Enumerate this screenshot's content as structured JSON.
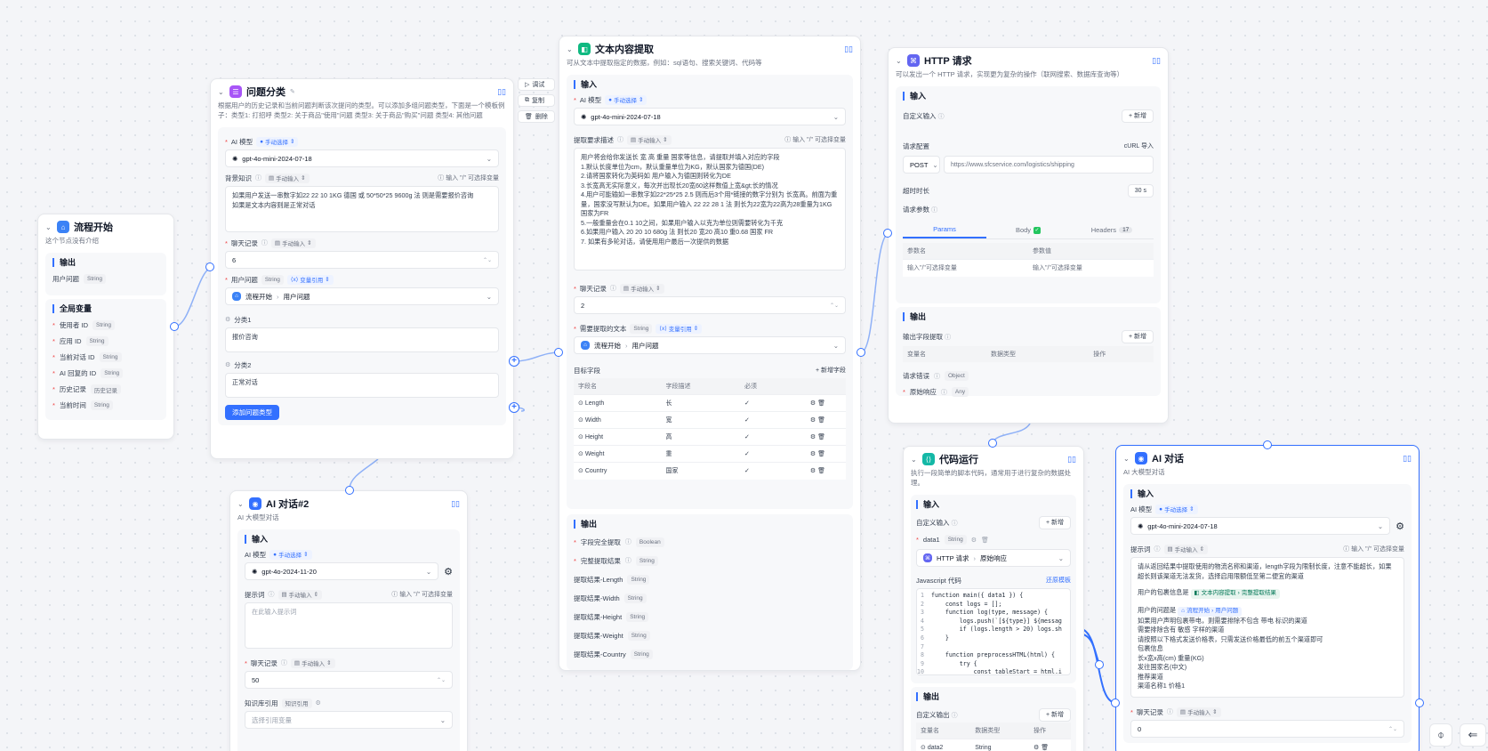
{
  "start": {
    "title": "流程开始",
    "desc": "这个节点没有介绍",
    "output_label": "输出",
    "output_field": "用户问题",
    "output_type": "String",
    "globals_label": "全局变量",
    "globals": [
      {
        "name": "使用者 ID",
        "type": "String"
      },
      {
        "name": "应用 ID",
        "type": "String"
      },
      {
        "name": "当前对话 ID",
        "type": "String"
      },
      {
        "name": "AI 回复的 ID",
        "type": "String"
      },
      {
        "name": "历史记录",
        "type": "历史记录"
      },
      {
        "name": "当前时间",
        "type": "String"
      }
    ]
  },
  "toolbar": {
    "debug": "调试",
    "copy": "复制",
    "delete": "删除"
  },
  "classify": {
    "title": "问题分类",
    "desc": "根据用户的历史记录和当前问题判断该次提问的类型。可以添加多组问题类型，下面是一个模板例子：类型1: 打招呼 类型2: 关于商品\"使用\"问题 类型3: 关于商品\"购买\"问题 类型4: 其他问题",
    "model_label": "AI 模型",
    "mode": "手动选择",
    "model": "gpt-4o-mini-2024-07-18",
    "bg_label": "背景知识",
    "manual": "手动输入",
    "hint": "输入 \"/\" 可选择变量",
    "bg_text": "如果用户发送一串数字如22 22 10 1KG 德国 或 50*50*25 9600g 法 则是需要报价咨询\n如果是文本内容则是正常对话",
    "history_label": "聊天记录",
    "history_val": "6",
    "q_label": "用户问题",
    "q_type": "String",
    "ref": "变量引用",
    "q_ref_a": "流程开始",
    "q_ref_b": "用户问题",
    "class1_label": "分类1",
    "class1_val": "报价咨询",
    "class2_label": "分类2",
    "class2_val": "正常对话",
    "add_btn": "添加问题类型"
  },
  "extract": {
    "title": "文本内容提取",
    "desc": "可从文本中提取指定的数据，例如：sql语句、搜索关键词、代码等",
    "input_label": "输入",
    "model_label": "AI 模型",
    "mode": "手动选择",
    "model": "gpt-4o-mini-2024-07-18",
    "req_label": "提取要求描述",
    "manual": "手动输入",
    "hint": "输入 \"/\" 可选择变量",
    "req_text": "用户将会给你发送长 宽 高 重量 国家等信息，请提取并填入对应的字段\n1.默认长度单位为cm，默认重量单位为KG，默认国家为德国(DE)\n2.请将国家转化为英码如 用户输入为德国则转化为DE\n3.长宽高无实际意义，每次并出现长20宽60这样数值上宽&gt;长的情况\n4.用户可能输如一串数字如22*25*25 2.5 则而后3个用*链接的数字分别为 长宽高。前面为重量，国家没写默认为DE。如果用户输入 22 22 28 1 法 则长为22宽为22高为28重量为1KG 国家为FR\n5.一般重量会在0.1  10之间，如果用户输入以克为单位则需要转化为千克\n6.如果用户输入 20 20 10 680g 法 则长20 宽20 高10 重0.68 国家 FR\n7. 如果有多轮对话，请使用用户最后一次提供的数据",
    "history_label": "聊天记录",
    "history_val": "2",
    "text_label": "需要提取的文本",
    "text_type": "String",
    "ref": "变量引用",
    "text_ref_a": "流程开始",
    "text_ref_b": "用户问题",
    "target_label": "目标字段",
    "add_field": "+ 新增字段",
    "cols": [
      "字段名",
      "字段描述",
      "必须"
    ],
    "fields": [
      {
        "name": "Length",
        "desc": "长"
      },
      {
        "name": "Width",
        "desc": "宽"
      },
      {
        "name": "Height",
        "desc": "高"
      },
      {
        "name": "Weight",
        "desc": "重"
      },
      {
        "name": "Country",
        "desc": "国家"
      }
    ],
    "output_label": "输出",
    "outputs": [
      {
        "name": "字段完全提取",
        "type": "Boolean",
        "req": true
      },
      {
        "name": "完整提取结果",
        "type": "String",
        "req": true
      },
      {
        "name": "提取结果-Length",
        "type": "String",
        "req": false
      },
      {
        "name": "提取结果-Width",
        "type": "String",
        "req": false
      },
      {
        "name": "提取结果-Height",
        "type": "String",
        "req": false
      },
      {
        "name": "提取结果-Weight",
        "type": "String",
        "req": false
      },
      {
        "name": "提取结果-Country",
        "type": "String",
        "req": false
      }
    ]
  },
  "http": {
    "title": "HTTP 请求",
    "desc": "可以发出一个 HTTP 请求，实现更为复杂的操作（联网搜索、数据库查询等）",
    "input_label": "输入",
    "custom_input": "自定义输入",
    "add": "+ 新增",
    "config_label": "请求配置",
    "curl": "cURL 导入",
    "method": "POST",
    "url": "https://www.sfcservice.com/logistics/shipping",
    "timeout_label": "超时时长",
    "timeout": "30 s",
    "params_label": "请求参数",
    "tabs": [
      "Params",
      "Body",
      "Headers"
    ],
    "headers_count": "17",
    "cols": [
      "参数名",
      "参数值"
    ],
    "row_name": "输入\"/\"可选择变量",
    "row_val": "输入\"/\"可选择变量",
    "output_label": "输出",
    "out_extract": "输出字段提取",
    "out_cols": [
      "变量名",
      "数据类型",
      "操作"
    ],
    "err_label": "请求错误",
    "err_type": "Object",
    "raw_label": "原始响应",
    "raw_type": "Any"
  },
  "code": {
    "title": "代码运行",
    "desc": "执行一段简单的脚本代码，通常用于进行复杂的数据处理。",
    "input_label": "输入",
    "custom_input": "自定义输入",
    "add": "+ 新增",
    "var_name": "data1",
    "var_type": "String",
    "ref_a": "HTTP 请求",
    "ref_b": "原始响应",
    "js_label": "Javascript 代码",
    "restore": "还原模板",
    "lines": [
      "function main({ data1 }) {",
      "    const logs = [];",
      "    function log(type, message) {",
      "        logs.push(`[${type}] ${messag",
      "        if (logs.length > 20) logs.sh",
      "    }",
      "",
      "    function preprocessHTML(html) {",
      "        try {",
      "            const tableStart = html.i"
    ],
    "output_label": "输出",
    "custom_output": "自定义输出",
    "out_cols": [
      "变量名",
      "数据类型",
      "操作"
    ],
    "out_row_name": "data2",
    "out_row_type": "String"
  },
  "ai2": {
    "title": "AI 对话#2",
    "desc": "AI 大模型对话",
    "input_label": "输入",
    "model_label": "AI 模型",
    "mode": "手动选择",
    "model": "gpt-4o-2024-11-20",
    "prompt_label": "提示词",
    "manual": "手动输入",
    "hint": "输入 \"/\" 可选择变量",
    "prompt_ph": "在此输入提示词",
    "history_label": "聊天记录",
    "history_val": "50",
    "kb_label": "知识库引用",
    "kb_tag": "知识引用",
    "kb_ph": "选择引用变量"
  },
  "ai1": {
    "title": "AI 对话",
    "desc": "AI 大模型对话",
    "input_label": "输入",
    "model_label": "AI 模型",
    "mode": "手动选择",
    "model": "gpt-4o-mini-2024-07-18",
    "prompt_label": "提示词",
    "manual": "手动输入",
    "hint": "输入 \"/\" 可选择变量",
    "p1": "请从返回结果中提取使用的物流名称和渠道，length字段为限制长度，注意不能超长，如果超长则该渠道无法发货，选择启用限额低至第二便宜的渠道",
    "p2a": "用户的包裹信息是",
    "p2b": "文本内容提取",
    "p2c": "完整提取结果",
    "p3a": "用户的问题是",
    "p3b": "流程开始",
    "p3c": "用户问题",
    "p4": "如果用户声明包裹带电，则需要排除不包含 带电 标识的渠道\n需要排除含有 敏感 字样的渠道\n请按照以下格式发送价格表，只需发送价格最低的前五个渠道即可\n包裹信息\n   长x宽x高(cm) 重量(KG)\n   发往国家名(中文)\n推荐渠道\n   渠道名称1 价格1",
    "history_label": "聊天记录",
    "history_val": "0"
  }
}
